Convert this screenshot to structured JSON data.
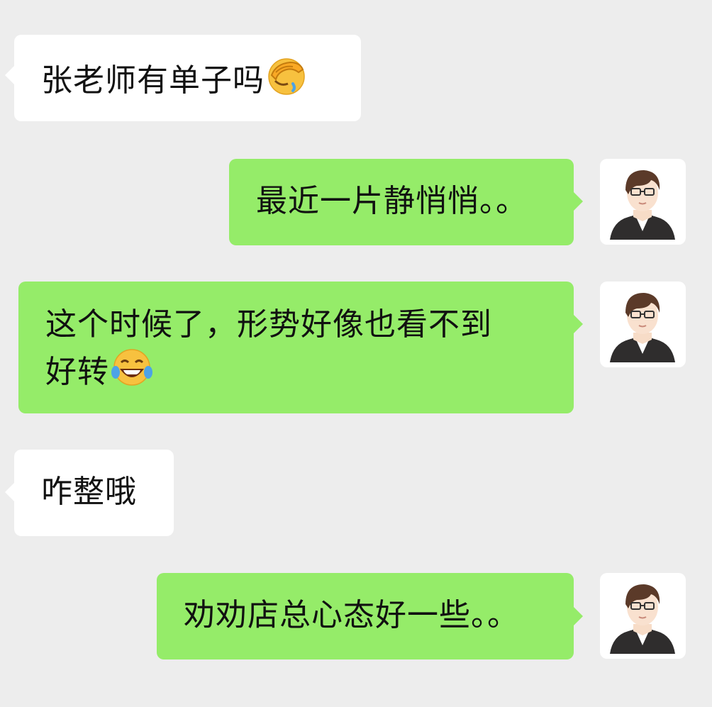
{
  "messages": [
    {
      "side": "left",
      "text": "张老师有单子吗",
      "emoji": "facepalm-emoji"
    },
    {
      "side": "right",
      "text": "最近一片静悄悄。。",
      "emoji": ""
    },
    {
      "side": "right",
      "text": "这个时候了，形势好像也看不到",
      "text2": "好转",
      "emoji": "tears-of-joy-emoji"
    },
    {
      "side": "left",
      "text": "咋整哦",
      "emoji": ""
    },
    {
      "side": "right",
      "text": "劝劝店总心态好一些。。",
      "emoji": ""
    }
  ],
  "avatar_icon": "cartoon-man-with-glasses-avatar",
  "colors": {
    "background": "#ededed",
    "incoming_bubble": "#ffffff",
    "outgoing_bubble": "#95ec69"
  }
}
